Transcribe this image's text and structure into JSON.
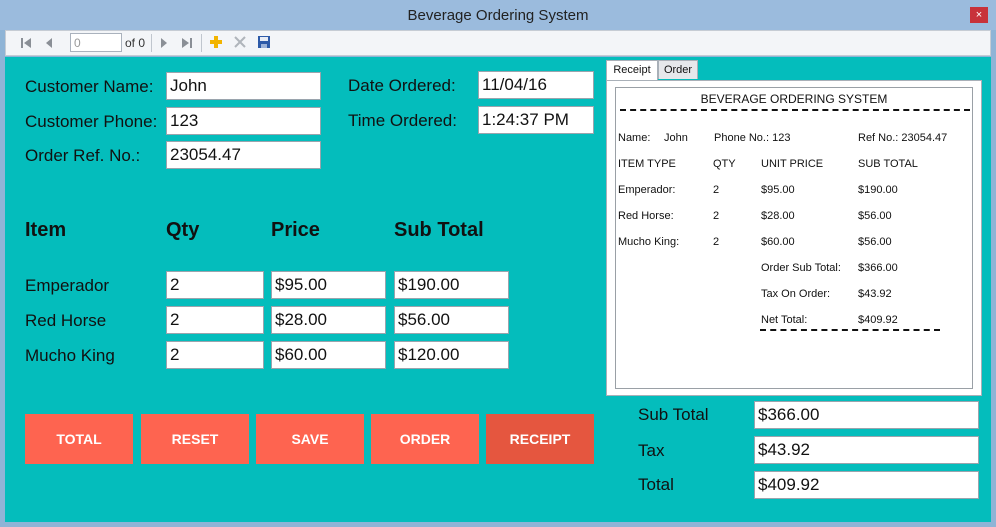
{
  "window": {
    "title": "Beverage Ordering System",
    "close_glyph": "×"
  },
  "navigator": {
    "position": "0",
    "of_text": "of 0"
  },
  "customer": {
    "name_label": "Customer Name:",
    "name_value": "John",
    "phone_label": "Customer Phone:",
    "phone_value": "123",
    "ref_label": "Order Ref. No.:",
    "ref_value": "23054.47",
    "date_label": "Date Ordered:",
    "date_value": "11/04/16",
    "time_label": "Time Ordered:",
    "time_value": "1:24:37 PM"
  },
  "items_header": {
    "item": "Item",
    "qty": "Qty",
    "price": "Price",
    "subtotal": "Sub Total"
  },
  "items": [
    {
      "name": "Emperador",
      "qty": "2",
      "price": "$95.00",
      "subtotal": "$190.00"
    },
    {
      "name": "Red Horse",
      "qty": "2",
      "price": "$28.00",
      "subtotal": "$56.00"
    },
    {
      "name": "Mucho King",
      "qty": "2",
      "price": "$60.00",
      "subtotal": "$120.00"
    }
  ],
  "buttons": {
    "total": "TOTAL",
    "reset": "RESET",
    "save": "SAVE",
    "order": "ORDER",
    "receipt": "RECEIPT"
  },
  "tabs": {
    "receipt": "Receipt",
    "order": "Order"
  },
  "receipt": {
    "title": "BEVERAGE ORDERING SYSTEM",
    "name_label": "Name:",
    "name_value": "John",
    "phone_text": "Phone No.: 123",
    "ref_text": "Ref No.: 23054.47",
    "col_item": "ITEM TYPE",
    "col_qty": "QTY",
    "col_price": "UNIT PRICE",
    "col_sub": "SUB TOTAL",
    "rows": [
      {
        "name": "Emperador:",
        "qty": "2",
        "price": "$95.00",
        "sub": "$190.00"
      },
      {
        "name": "Red Horse:",
        "qty": "2",
        "price": "$28.00",
        "sub": "$56.00"
      },
      {
        "name": "Mucho King:",
        "qty": "2",
        "price": "$60.00",
        "sub": "$56.00"
      }
    ],
    "order_sub_label": "Order Sub Total:",
    "order_sub_value": "$366.00",
    "tax_label": "Tax On Order:",
    "tax_value": "$43.92",
    "net_label": "Net Total:",
    "net_value": "$409.92"
  },
  "totals": {
    "sub_label": "Sub Total",
    "sub_value": "$366.00",
    "tax_label": "Tax",
    "tax_value": "$43.92",
    "total_label": "Total",
    "total_value": "$409.92"
  },
  "icons": [
    "move-first-icon",
    "move-previous-icon",
    "move-next-icon",
    "move-last-icon",
    "add-new-icon",
    "delete-icon",
    "save-icon"
  ],
  "colors": {
    "client_bg": "#04bdbc",
    "button_bg": "#fe6450",
    "titlebar_bg": "#9bbbdd"
  }
}
